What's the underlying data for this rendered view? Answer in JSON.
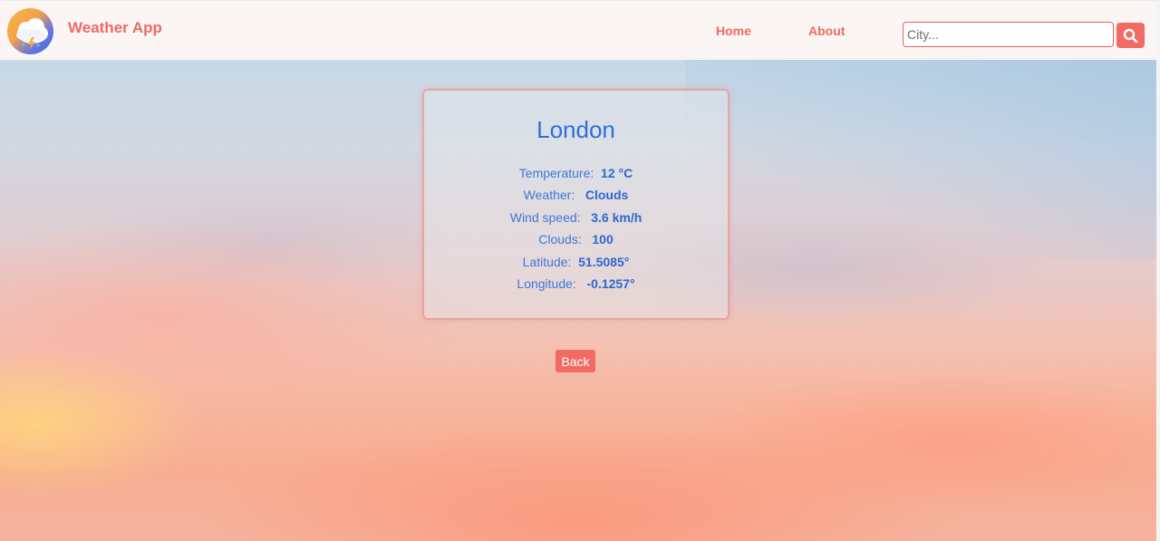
{
  "header": {
    "app_name": "Weather App",
    "logo_icon": "weather-cloud-lightning-icon",
    "nav": [
      {
        "label": "Home"
      },
      {
        "label": "About"
      }
    ],
    "search": {
      "placeholder": "City...",
      "value": "",
      "button_icon": "search-icon"
    }
  },
  "weather": {
    "city": "London",
    "rows": [
      {
        "label": "Temperature:",
        "value": "12 °C"
      },
      {
        "label": "Weather:",
        "value": "Clouds"
      },
      {
        "label": "Wind speed:",
        "value": "3.6 km/h"
      },
      {
        "label": "Clouds:",
        "value": "100"
      },
      {
        "label": "Latitude:",
        "value": "51.5085°"
      },
      {
        "label": "Longitude:",
        "value": "-0.1257°"
      }
    ]
  },
  "actions": {
    "back_label": "Back"
  },
  "colors": {
    "accent": "#ef6b63",
    "text_blue": "#2f6fd8",
    "navbar_bg": "#fbf5f4"
  }
}
